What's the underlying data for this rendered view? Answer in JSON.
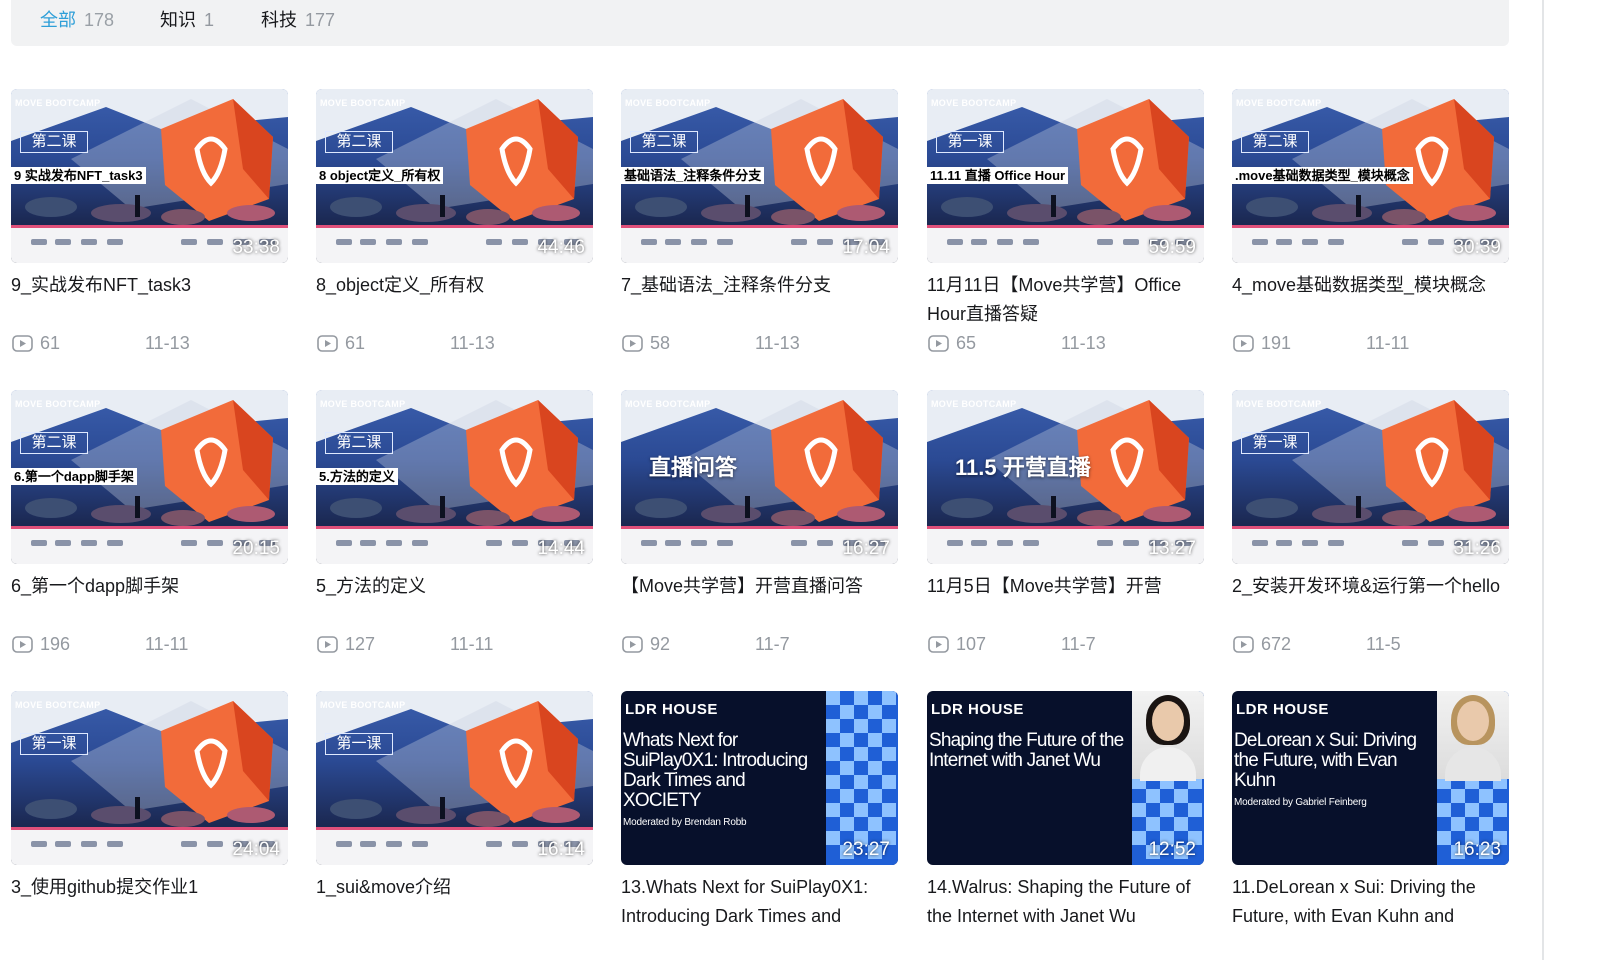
{
  "tabs": [
    {
      "label": "全部",
      "count": "178",
      "active": true
    },
    {
      "label": "知识",
      "count": "1",
      "active": false
    },
    {
      "label": "科技",
      "count": "177",
      "active": false
    }
  ],
  "cover_text": {
    "brand": "MOVE BOOTCAMP"
  },
  "videos": [
    {
      "title": "9_实战发布NFT_task3",
      "duration": "33:38",
      "plays": "61",
      "date": "11-13",
      "cover": "bootcamp",
      "lesson": "第二课",
      "cover_label": "9 实战发布NFT_task3"
    },
    {
      "title": "8_object定义_所有权",
      "duration": "44:46",
      "plays": "61",
      "date": "11-13",
      "cover": "bootcamp",
      "lesson": "第二课",
      "cover_label": "8 object定义_所有权"
    },
    {
      "title": "7_基础语法_注释条件分支",
      "duration": "17:04",
      "plays": "58",
      "date": "11-13",
      "cover": "bootcamp",
      "lesson": "第二课",
      "cover_label": "基础语法_注释条件分支"
    },
    {
      "title": "11月11日【Move共学营】Office Hour直播答疑",
      "duration": "59:59",
      "plays": "65",
      "date": "11-13",
      "cover": "bootcamp",
      "lesson": "第一课",
      "cover_label": "11.11  直播 Office Hour"
    },
    {
      "title": "4_move基础数据类型_模块概念",
      "duration": "30:39",
      "plays": "191",
      "date": "11-11",
      "cover": "bootcamp",
      "lesson": "第二课",
      "cover_label": ".move基础数据类型_模块概念"
    },
    {
      "title": "6_第一个dapp脚手架",
      "duration": "20:15",
      "plays": "196",
      "date": "11-11",
      "cover": "bootcamp",
      "lesson": "第二课",
      "cover_label": "6.第一个dapp脚手架"
    },
    {
      "title": "5_方法的定义",
      "duration": "14:44",
      "plays": "127",
      "date": "11-11",
      "cover": "bootcamp",
      "lesson": "第二课",
      "cover_label": "5.方法的定义"
    },
    {
      "title": "【Move共学营】开营直播问答",
      "duration": "16:27",
      "plays": "92",
      "date": "11-7",
      "cover": "bootcamp-big",
      "big_text": "直播问答"
    },
    {
      "title": "11月5日【Move共学营】开营",
      "duration": "13:27",
      "plays": "107",
      "date": "11-7",
      "cover": "bootcamp-big",
      "big_text": "11.5 开营直播"
    },
    {
      "title": "2_安装开发环境&运行第一个hello",
      "duration": "31:26",
      "plays": "672",
      "date": "11-5",
      "cover": "bootcamp",
      "lesson": "第一课",
      "cover_label": ""
    },
    {
      "title": "3_使用github提交作业1",
      "duration": "24:04",
      "plays": "",
      "date": "",
      "cover": "bootcamp",
      "lesson": "第一课",
      "cover_label": ""
    },
    {
      "title": "1_sui&move介绍",
      "duration": "16:14",
      "plays": "",
      "date": "",
      "cover": "bootcamp",
      "lesson": "第一课",
      "cover_label": ""
    },
    {
      "title": "13.Whats Next for SuiPlay0X1: Introducing Dark Times and",
      "duration": "23:27",
      "plays": "",
      "date": "",
      "cover": "ldr",
      "ldr_title": "Whats Next for SuiPlay0X1: Introducing Dark Times and XOCIETY",
      "ldr_mod": "Moderated by Brendan Robb",
      "photo": "none"
    },
    {
      "title": "14.Walrus: Shaping the Future of the Internet with Janet Wu",
      "duration": "12:52",
      "plays": "",
      "date": "",
      "cover": "ldr",
      "ldr_title": "Shaping the Future of the Internet with Janet Wu",
      "ldr_mod": "",
      "photo": "woman"
    },
    {
      "title": "11.DeLorean x Sui: Driving the Future, with Evan Kuhn and",
      "duration": "16:23",
      "plays": "",
      "date": "",
      "cover": "ldr",
      "ldr_title": "DeLorean x Sui: Driving the Future, with Evan Kuhn",
      "ldr_mod": "Moderated by Gabriel Feinberg",
      "photo": "man"
    }
  ],
  "ldr_logo": "LDR HOUSE",
  "colors": {
    "accent": "#2e9fd8",
    "meta": "#9499a0",
    "tabbar": "#f1f2f3"
  }
}
